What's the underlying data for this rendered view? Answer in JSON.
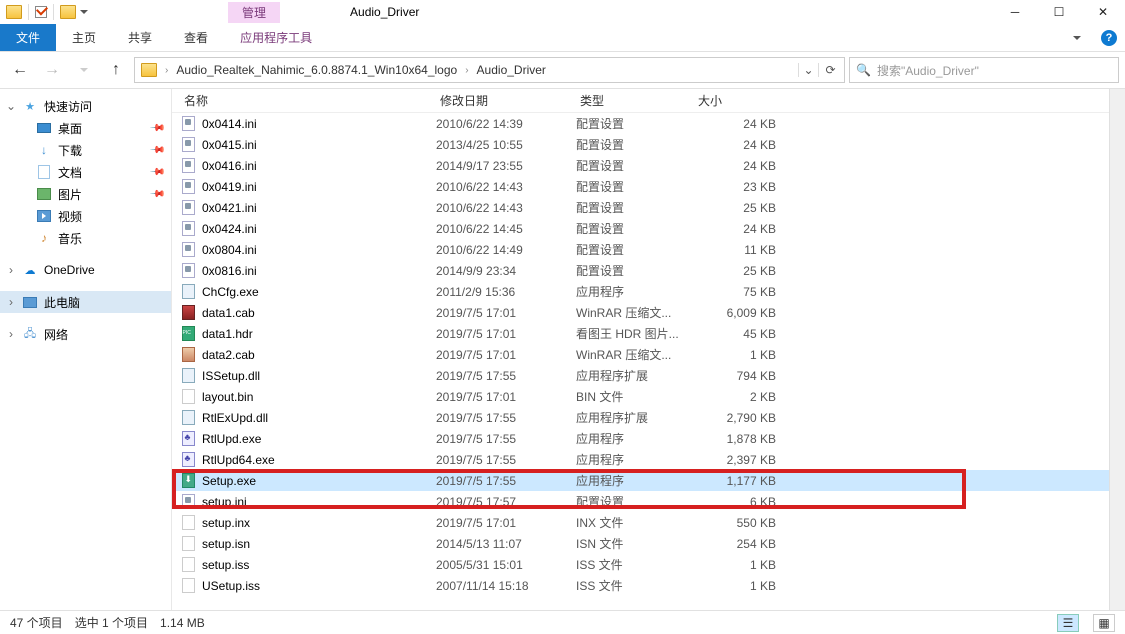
{
  "window": {
    "contextTab": "管理",
    "title": "Audio_Driver"
  },
  "ribbon": {
    "file": "文件",
    "tabs": [
      "主页",
      "共享",
      "查看"
    ],
    "toolTab": "应用程序工具"
  },
  "breadcrumb": {
    "parts": [
      "Audio_Realtek_Nahimic_6.0.8874.1_Win10x64_logo",
      "Audio_Driver"
    ]
  },
  "search": {
    "placeholder": "搜索\"Audio_Driver\""
  },
  "navpane": {
    "quickAccess": "快速访问",
    "items": [
      {
        "label": "桌面",
        "pinned": true
      },
      {
        "label": "下载",
        "pinned": true
      },
      {
        "label": "文档",
        "pinned": true
      },
      {
        "label": "图片",
        "pinned": true
      },
      {
        "label": "视频",
        "pinned": false
      },
      {
        "label": "音乐",
        "pinned": false
      }
    ],
    "oneDrive": "OneDrive",
    "thisPC": "此电脑",
    "network": "网络"
  },
  "columns": {
    "name": "名称",
    "date": "修改日期",
    "type": "类型",
    "size": "大小"
  },
  "files": [
    {
      "icon": "ini",
      "name": "0x0414.ini",
      "date": "2010/6/22 14:39",
      "type": "配置设置",
      "size": "24 KB"
    },
    {
      "icon": "ini",
      "name": "0x0415.ini",
      "date": "2013/4/25 10:55",
      "type": "配置设置",
      "size": "24 KB"
    },
    {
      "icon": "ini",
      "name": "0x0416.ini",
      "date": "2014/9/17 23:55",
      "type": "配置设置",
      "size": "24 KB"
    },
    {
      "icon": "ini",
      "name": "0x0419.ini",
      "date": "2010/6/22 14:43",
      "type": "配置设置",
      "size": "23 KB"
    },
    {
      "icon": "ini",
      "name": "0x0421.ini",
      "date": "2010/6/22 14:43",
      "type": "配置设置",
      "size": "25 KB"
    },
    {
      "icon": "ini",
      "name": "0x0424.ini",
      "date": "2010/6/22 14:45",
      "type": "配置设置",
      "size": "24 KB"
    },
    {
      "icon": "ini",
      "name": "0x0804.ini",
      "date": "2010/6/22 14:49",
      "type": "配置设置",
      "size": "11 KB"
    },
    {
      "icon": "ini",
      "name": "0x0816.ini",
      "date": "2014/9/9 23:34",
      "type": "配置设置",
      "size": "25 KB"
    },
    {
      "icon": "exe",
      "name": "ChCfg.exe",
      "date": "2011/2/9 15:36",
      "type": "应用程序",
      "size": "75 KB"
    },
    {
      "icon": "cab",
      "name": "data1.cab",
      "date": "2019/7/5 17:01",
      "type": "WinRAR 压缩文...",
      "size": "6,009 KB"
    },
    {
      "icon": "hdr",
      "name": "data1.hdr",
      "date": "2019/7/5 17:01",
      "type": "看图王 HDR 图片...",
      "size": "45 KB"
    },
    {
      "icon": "cab2",
      "name": "data2.cab",
      "date": "2019/7/5 17:01",
      "type": "WinRAR 压缩文...",
      "size": "1 KB"
    },
    {
      "icon": "exe",
      "name": "ISSetup.dll",
      "date": "2019/7/5 17:55",
      "type": "应用程序扩展",
      "size": "794 KB"
    },
    {
      "icon": "blank",
      "name": "layout.bin",
      "date": "2019/7/5 17:01",
      "type": "BIN 文件",
      "size": "2 KB"
    },
    {
      "icon": "exe",
      "name": "RtlExUpd.dll",
      "date": "2019/7/5 17:55",
      "type": "应用程序扩展",
      "size": "2,790 KB"
    },
    {
      "icon": "rtl",
      "name": "RtlUpd.exe",
      "date": "2019/7/5 17:55",
      "type": "应用程序",
      "size": "1,878 KB"
    },
    {
      "icon": "rtl",
      "name": "RtlUpd64.exe",
      "date": "2019/7/5 17:55",
      "type": "应用程序",
      "size": "2,397 KB"
    },
    {
      "icon": "setup",
      "name": "Setup.exe",
      "date": "2019/7/5 17:55",
      "type": "应用程序",
      "size": "1,177 KB",
      "selected": true
    },
    {
      "icon": "ini",
      "name": "setup.ini",
      "date": "2019/7/5 17:57",
      "type": "配置设置",
      "size": "6 KB"
    },
    {
      "icon": "blank",
      "name": "setup.inx",
      "date": "2019/7/5 17:01",
      "type": "INX 文件",
      "size": "550 KB"
    },
    {
      "icon": "blank",
      "name": "setup.isn",
      "date": "2014/5/13 11:07",
      "type": "ISN 文件",
      "size": "254 KB"
    },
    {
      "icon": "blank",
      "name": "setup.iss",
      "date": "2005/5/31 15:01",
      "type": "ISS 文件",
      "size": "1 KB"
    },
    {
      "icon": "blank",
      "name": "USetup.iss",
      "date": "2007/11/14 15:18",
      "type": "ISS 文件",
      "size": "1 KB"
    }
  ],
  "status": {
    "itemCount": "47 个项目",
    "selection": "选中 1 个项目",
    "selSize": "1.14 MB"
  }
}
